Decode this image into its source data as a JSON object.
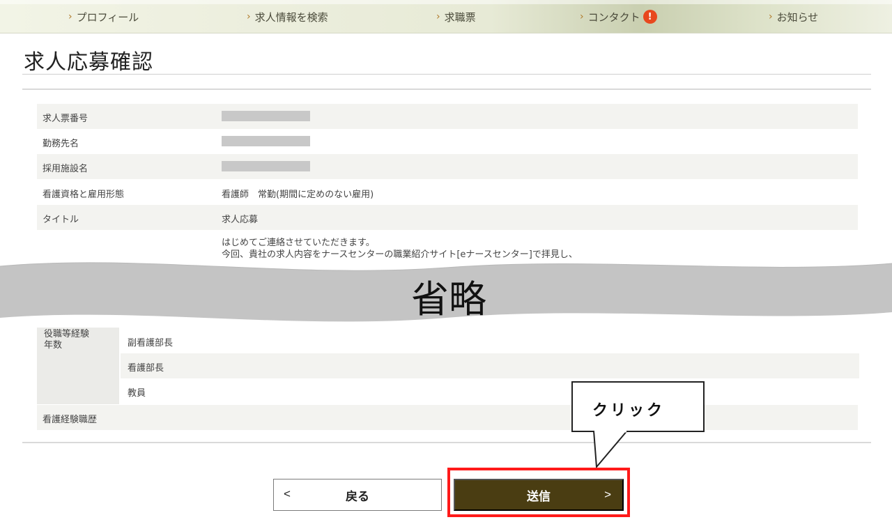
{
  "nav": {
    "items": [
      {
        "label": "プロフィール"
      },
      {
        "label": "求人情報を検索"
      },
      {
        "label": "求職票"
      },
      {
        "label": "コンタクト",
        "badge": "!"
      },
      {
        "label": "お知らせ"
      }
    ]
  },
  "page": {
    "title": "求人応募確認"
  },
  "table": {
    "rows": [
      {
        "label": "求人票番号"
      },
      {
        "label": "勤務先名"
      },
      {
        "label": "採用施設名"
      },
      {
        "label": "看護資格と雇用形態",
        "value": "看護師　常勤(期間に定めのない雇用)"
      },
      {
        "label": "タイトル",
        "value": "求人応募"
      }
    ],
    "message_lines": [
      "はじめてご連絡させていただきます。",
      "今回、貴社の求人内容をナースセンターの職業紹介サイト[eナースセンター]で拝見し、"
    ],
    "experience_label_lines": [
      "役職等経験",
      "年数"
    ],
    "experience_items": [
      "副看護部長",
      "看護部長",
      "教員"
    ],
    "nursing_history_label": "看護経験職歴"
  },
  "omitted": {
    "text": "省略"
  },
  "buttons": {
    "back_label": "戻る",
    "send_label": "送信"
  },
  "callout": {
    "text": "クリック"
  },
  "colors": {
    "send_button": "#4a3d12",
    "highlight_frame": "#ff1a1a",
    "alert": "#e8481e"
  }
}
